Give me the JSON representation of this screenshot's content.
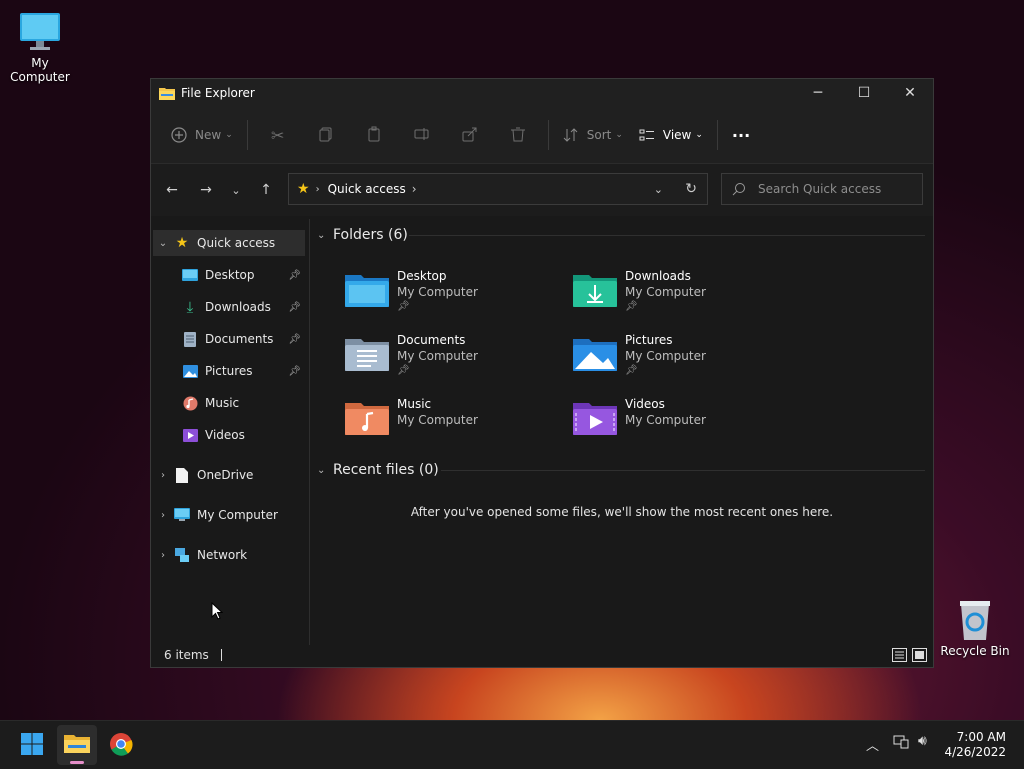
{
  "desktop": {
    "icons": [
      {
        "label": "My Computer"
      },
      {
        "label": "Recycle Bin"
      }
    ]
  },
  "window": {
    "title": "File Explorer",
    "controls": {
      "minimize": "─",
      "maximize": "☐",
      "close": "✕"
    }
  },
  "toolbar": {
    "new_label": "New",
    "sort_label": "Sort",
    "view_label": "View",
    "more_label": "···"
  },
  "address": {
    "location": "Quick access",
    "search_placeholder": "Search Quick access"
  },
  "sidebar": {
    "items": [
      {
        "label": "Quick access"
      },
      {
        "label": "Desktop"
      },
      {
        "label": "Downloads"
      },
      {
        "label": "Documents"
      },
      {
        "label": "Pictures"
      },
      {
        "label": "Music"
      },
      {
        "label": "Videos"
      },
      {
        "label": "OneDrive"
      },
      {
        "label": "My Computer"
      },
      {
        "label": "Network"
      }
    ]
  },
  "content": {
    "folders_header": "Folders (6)",
    "recent_header": "Recent files (0)",
    "empty_message": "After you've opened some files, we'll show the most recent ones here.",
    "folders": [
      {
        "name": "Desktop",
        "location": "My Computer"
      },
      {
        "name": "Downloads",
        "location": "My Computer"
      },
      {
        "name": "Documents",
        "location": "My Computer"
      },
      {
        "name": "Pictures",
        "location": "My Computer"
      },
      {
        "name": "Music",
        "location": "My Computer"
      },
      {
        "name": "Videos",
        "location": "My Computer"
      }
    ]
  },
  "status": {
    "items": "6 items"
  },
  "taskbar": {
    "time": "7:00 AM",
    "date": "4/26/2022"
  }
}
